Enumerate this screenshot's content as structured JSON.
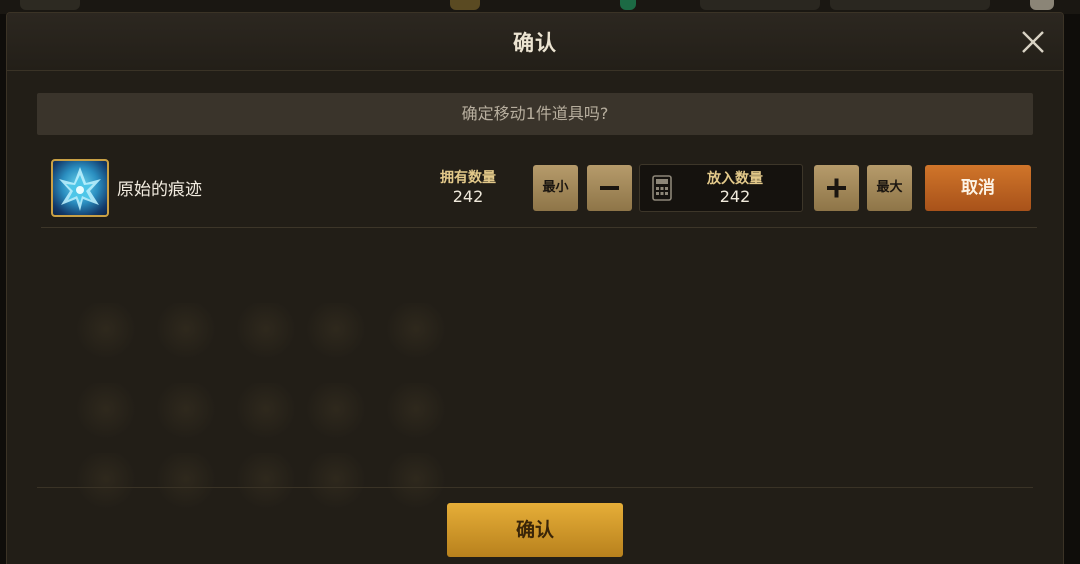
{
  "dialog": {
    "title": "确认",
    "question": "确定移动1件道具吗?"
  },
  "item": {
    "name": "原始的痕迹",
    "owned_label": "拥有数量",
    "owned_value": "242"
  },
  "controls": {
    "min_label": "最小",
    "max_label": "最大",
    "quantity_label": "放入数量",
    "quantity_value": "242",
    "cancel_label": "取消"
  },
  "footer": {
    "confirm_label": "确认"
  },
  "colors": {
    "dialog_bg": "#221e17",
    "gold_button": "#b69b6b",
    "cancel_button": "#c0651f",
    "confirm_button": "#d79e2e",
    "label_gold": "#e3c98a"
  },
  "icons": {
    "close": "close-icon",
    "item": "crystal-item-icon",
    "minus": "minus-icon",
    "plus": "plus-icon",
    "calculator": "calculator-icon"
  }
}
